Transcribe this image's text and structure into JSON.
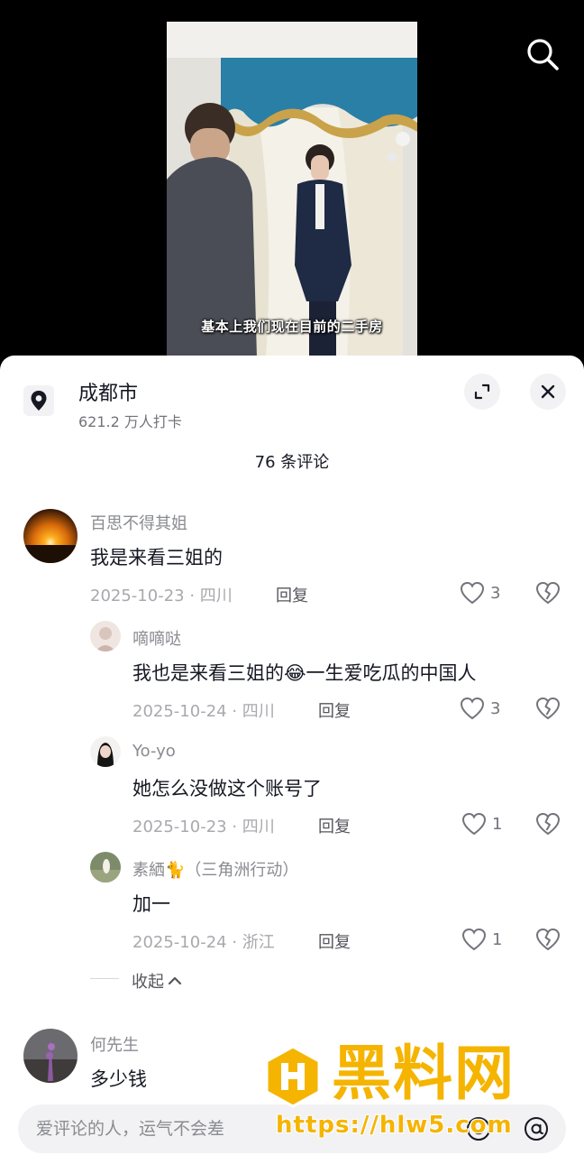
{
  "video": {
    "subtitle": "基本上我们现在目前的二手房"
  },
  "location": {
    "title": "成都市",
    "checkins": "621.2 万人打卡"
  },
  "comments_header": {
    "count_label": "76 条评论"
  },
  "comments": [
    {
      "username": "百思不得其姐",
      "text": "我是来看三姐的",
      "meta": "2025-10-23 · 四川",
      "reply_label": "回复",
      "likes": "3"
    },
    {
      "username": "嘀嘀哒",
      "text": "我也是来看三姐的😂一生爱吃瓜的中国人",
      "meta": "2025-10-24 · 四川",
      "reply_label": "回复",
      "likes": "3"
    },
    {
      "username": "Yo-yo",
      "text": "她怎么没做这个账号了",
      "meta": "2025-10-23 · 四川",
      "reply_label": "回复",
      "likes": "1"
    },
    {
      "username": "素絤🐈（三角洲行动）",
      "text": "加一",
      "meta": "2025-10-24 · 浙江",
      "reply_label": "回复",
      "likes": "1"
    },
    {
      "username": "何先生",
      "text": "多少钱"
    }
  ],
  "collapse_label": "收起",
  "input": {
    "placeholder": "爱评论的人，运气不会差"
  },
  "watermark": {
    "title": "黑料网",
    "url": "https://hlw5.com"
  },
  "icons": {
    "search": "search-icon",
    "location": "location-pin-icon",
    "expand": "expand-icon",
    "close": "close-icon",
    "like": "heart-icon",
    "dislike": "broken-heart-icon",
    "chevron": "chevron-up-icon",
    "emoji": "emoji-icon",
    "at": "at-icon"
  },
  "colors": {
    "accent": "#f5b400",
    "text_primary": "#161823",
    "text_secondary": "#8a8b91"
  }
}
